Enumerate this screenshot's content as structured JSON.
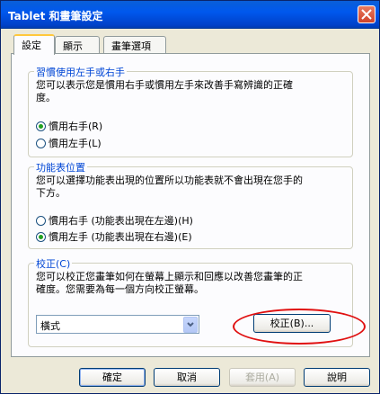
{
  "window": {
    "title": "Tablet 和畫筆設定"
  },
  "tabs": [
    {
      "label": "設定"
    },
    {
      "label": "顯示"
    },
    {
      "label": "畫筆選項"
    }
  ],
  "handedness": {
    "title": "習慣使用左手或右手",
    "desc_line1": "您可以表示您是慣用右手或慣用左手來改善手寫辨識的正確",
    "desc_line2": "度。",
    "right_label": "慣用右手(R)",
    "left_label": "慣用左手(L)",
    "selected": "right"
  },
  "menu_location": {
    "title": "功能表位置",
    "desc_line1": "您可以選擇功能表出現的位置所以功能表就不會出現在您手的",
    "desc_line2": "下方。",
    "right_label": "慣用右手 (功能表出現在左邊)(H)",
    "left_label": "慣用左手 (功能表出現在右邊)(E)",
    "selected": "left"
  },
  "calibrate": {
    "title": "校正(C)",
    "desc_line1": "您可以校正您畫筆如何在螢幕上顯示和回應以改善您畫筆的正",
    "desc_line2": "確度。您需要為每一個方向校正螢幕。",
    "orientation_value": "橫式",
    "button_label": "校正(B)..."
  },
  "footer": {
    "ok": "確定",
    "cancel": "取消",
    "apply": "套用(A)",
    "help": "說明"
  },
  "colors": {
    "title_bar": "#0058ee",
    "group_title": "#0046d5",
    "highlight_ring": "#e01010"
  }
}
